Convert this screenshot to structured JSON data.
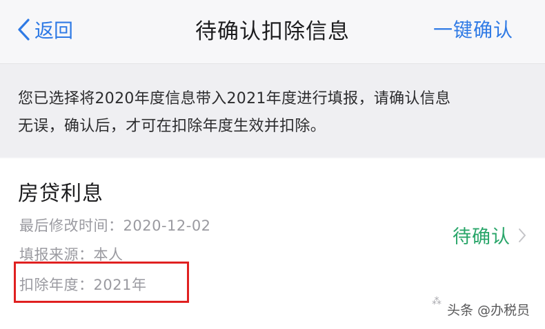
{
  "navbar": {
    "back_label": "返回",
    "title": "待确认扣除信息",
    "right_action": "一键确认"
  },
  "notice": {
    "line1": "您已选择将2020年度信息带入2021年度进行填报，请确认信息",
    "line2": "无误，确认后，才可在扣除年度生效并扣除。"
  },
  "item": {
    "title": "房贷利息",
    "last_modified": "最后修改时间：2020-12-02",
    "source": "填报来源：本人",
    "deduction_year": "扣除年度：2021年",
    "status": "待确认"
  },
  "watermark": {
    "text": "头条 @办税员"
  },
  "colors": {
    "link_blue": "#2f7ae5",
    "status_green": "#2aa66a",
    "highlight_red": "#e02020"
  },
  "icons": {
    "back": "chevron-left-icon",
    "status_arrow": "chevron-right-icon"
  }
}
